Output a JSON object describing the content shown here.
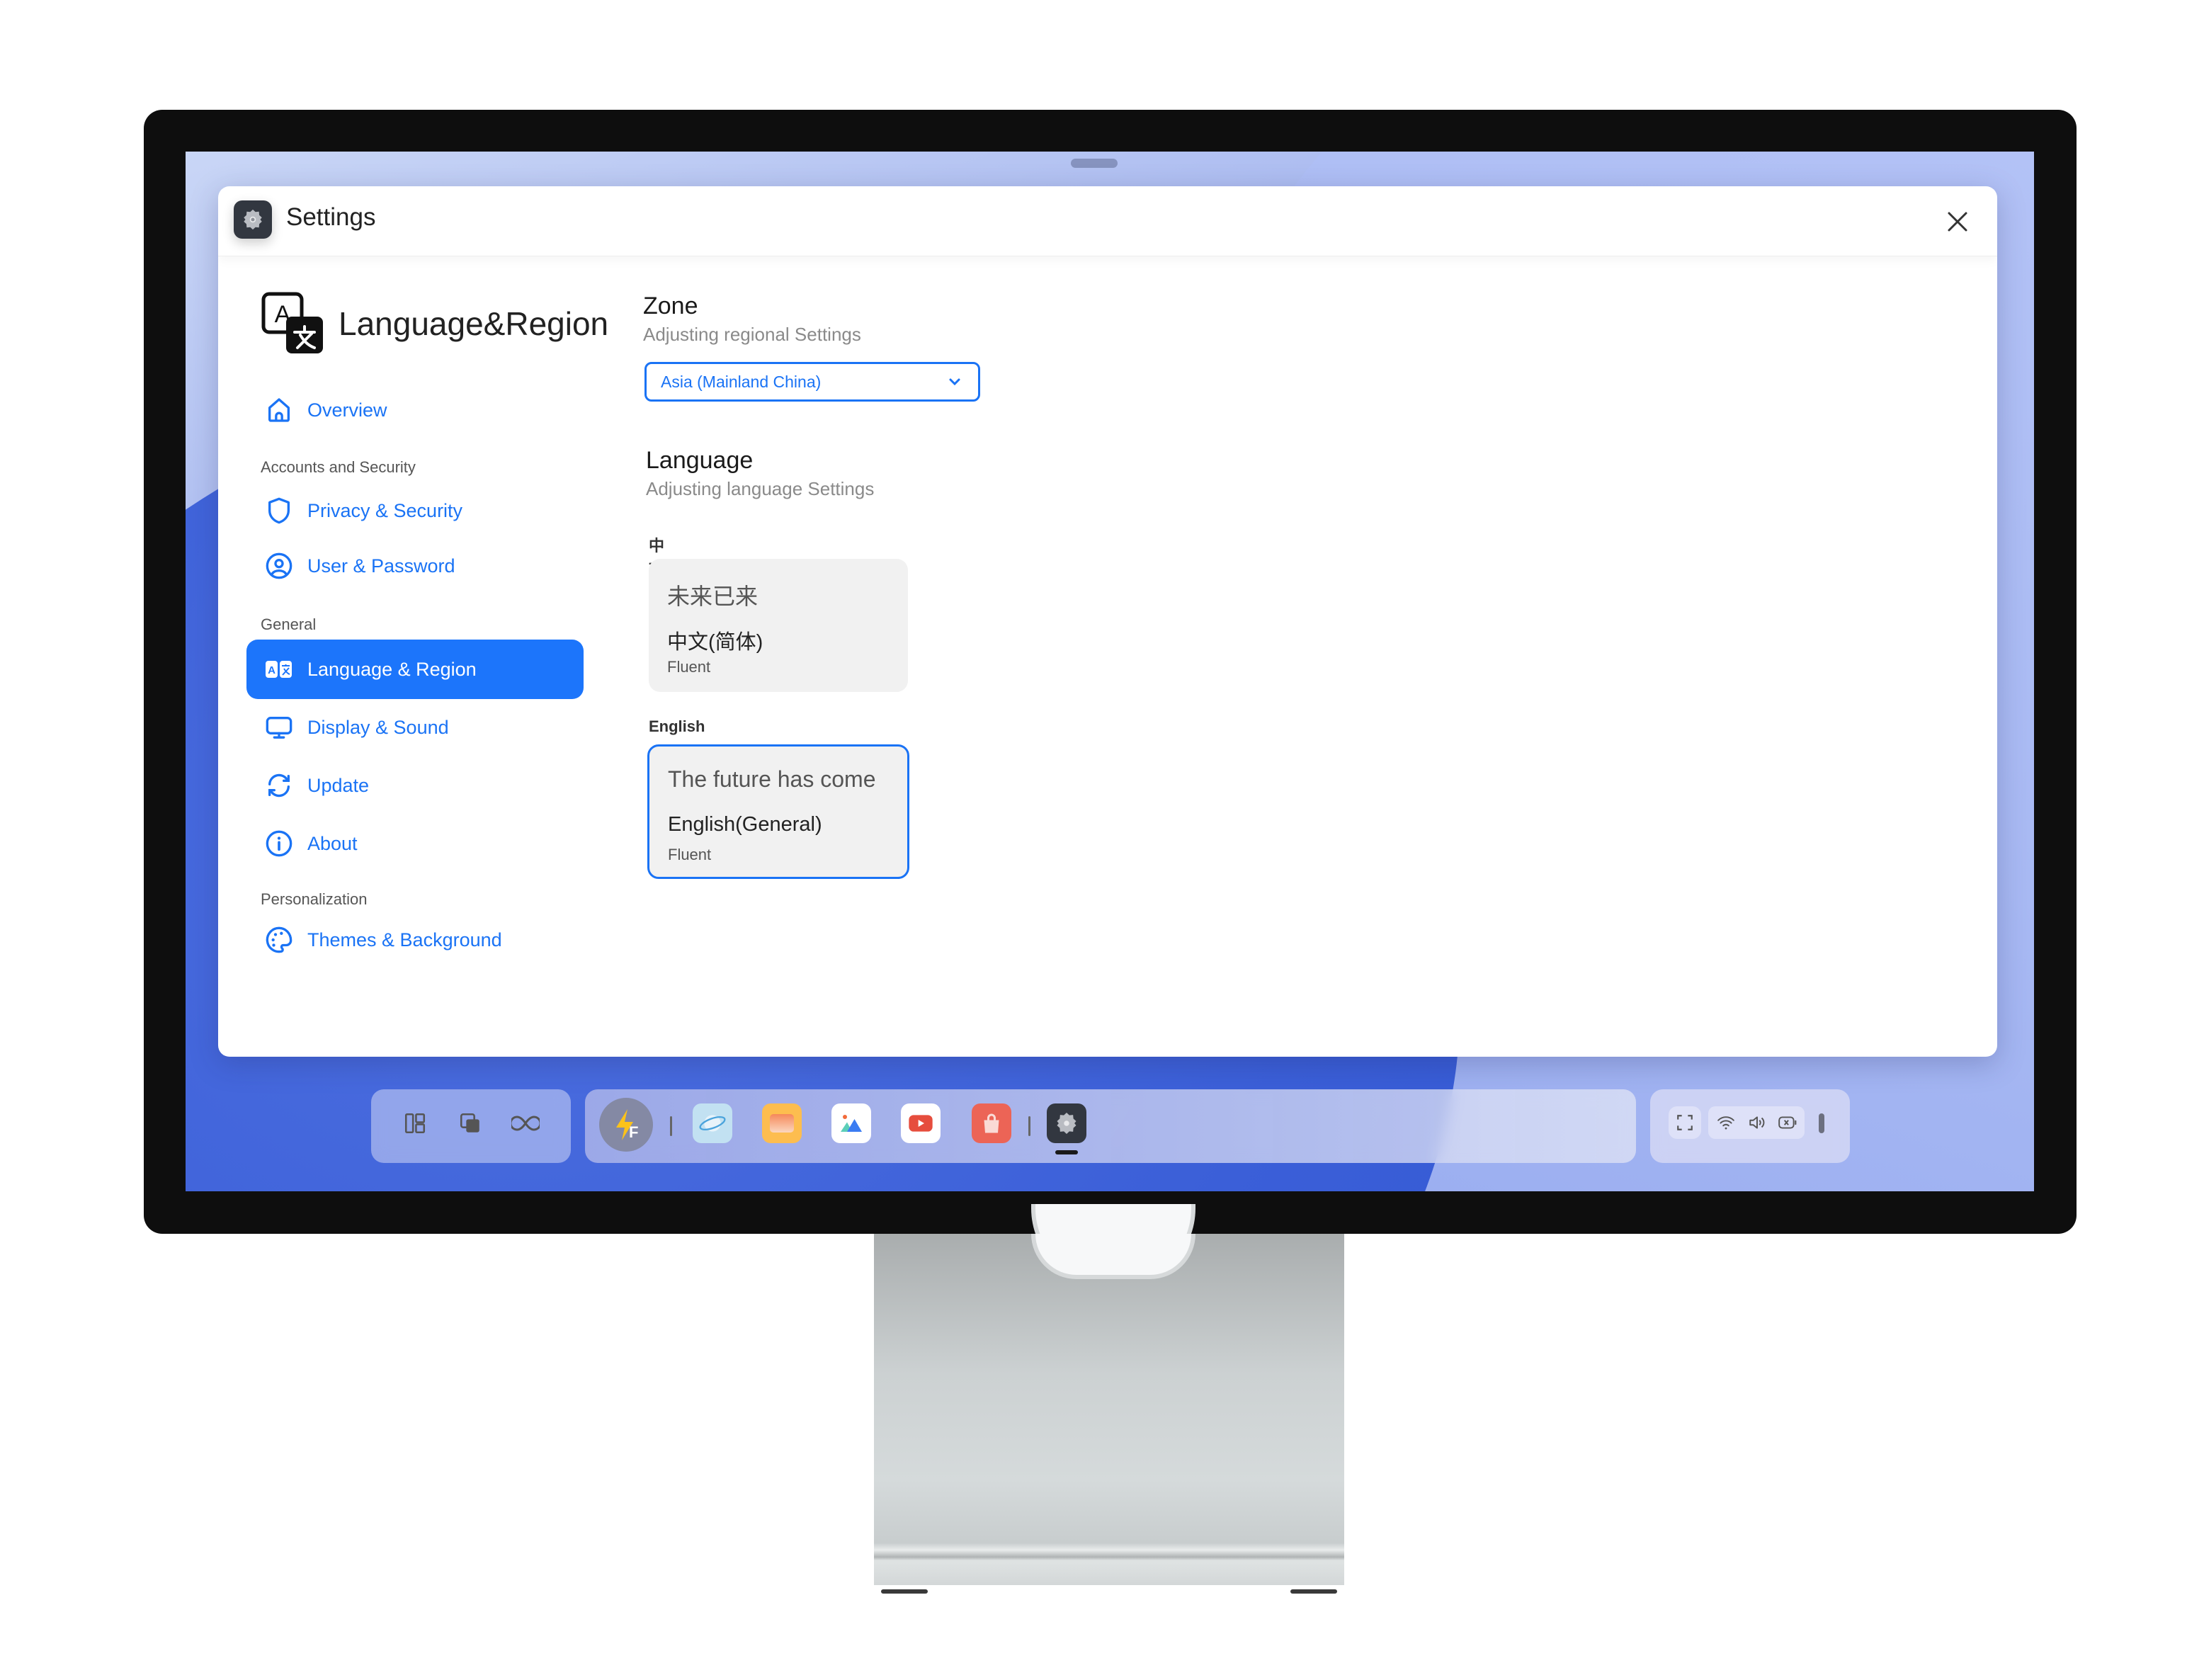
{
  "window": {
    "title": "Settings",
    "close_label": "Close"
  },
  "sidebar": {
    "heading": "Language&Region",
    "items": [
      {
        "label": "Overview",
        "icon": "home-icon"
      },
      {
        "section": "Accounts and Security"
      },
      {
        "label": "Privacy & Security",
        "icon": "shield-icon"
      },
      {
        "label": "User & Password",
        "icon": "user-circle-icon"
      },
      {
        "section": "General"
      },
      {
        "label": "Language &  Region",
        "icon": "translate-icon",
        "active": true
      },
      {
        "label": "Display & Sound",
        "icon": "monitor-icon"
      },
      {
        "label": "Update",
        "icon": "refresh-icon"
      },
      {
        "label": "About",
        "icon": "info-icon"
      },
      {
        "section": "Personalization"
      },
      {
        "label": "Themes & Background",
        "icon": "palette-icon"
      }
    ]
  },
  "zone": {
    "title": "Zone",
    "subtitle": "Adjusting regional Settings",
    "selected": "Asia (Mainland China)"
  },
  "language": {
    "title": "Language",
    "subtitle": "Adjusting language Settings",
    "options": [
      {
        "group": "中文",
        "sample": "未来已来",
        "name": "中文(简体)",
        "level": "Fluent",
        "selected": false
      },
      {
        "group": "English",
        "sample": "The future has come",
        "name": "English(General)",
        "level": "Fluent",
        "selected": true
      }
    ]
  },
  "dock": {
    "left": [
      "layout-icon",
      "window-switch-icon",
      "infinity-icon"
    ],
    "apps": [
      "flash-app-icon",
      "browser-icon",
      "files-icon",
      "gallery-icon",
      "video-icon",
      "store-icon",
      "settings-icon"
    ],
    "active_app": "settings-icon",
    "tray": [
      "fullscreen-icon",
      "wifi-icon",
      "volume-icon",
      "battery-icon"
    ]
  },
  "colors": {
    "accent": "#1c75fb",
    "text": "#222222",
    "muted": "#8a8a8a"
  }
}
